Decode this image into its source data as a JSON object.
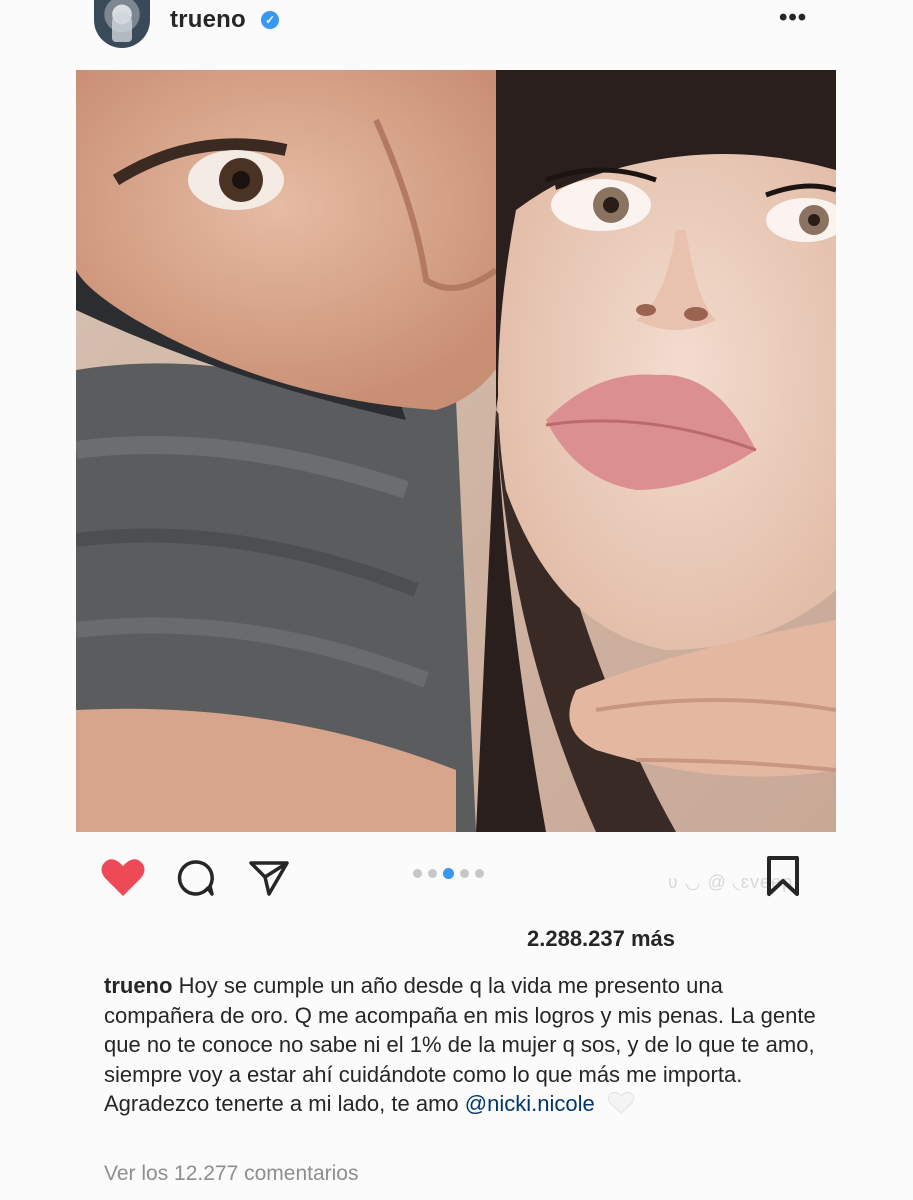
{
  "header": {
    "username": "trueno",
    "verified_icon": "verified-check-icon",
    "more_icon": "more-options-icon",
    "more_label": "•••"
  },
  "post": {
    "image_alt": "Selfie photo of two people",
    "carousel": {
      "total": 5,
      "active_index": 2
    },
    "watermark": "ʋ ◡ @ ◟ɛvɵɵp"
  },
  "actions": {
    "like_icon": "heart-filled-icon",
    "comment_icon": "comment-icon",
    "share_icon": "send-icon",
    "save_icon": "bookmark-icon",
    "like_color": "#ed4956"
  },
  "likes": {
    "text": "2.288.237 más"
  },
  "caption": {
    "username": "trueno",
    "text": "Hoy se cumple un año desde q la vida me presento una compañera de oro. Q me acompaña en mis logros y mis penas. La gente que no te conoce no sabe ni el 1% de la mujer q sos, y de lo que te amo, siempre voy a estar ahí cuidándote como lo que más me importa. Agradezco tenerte a mi lado, te amo",
    "mention": "@nicki.nicole",
    "emoji_icon": "white-heart-icon"
  },
  "comments": {
    "view_label": "Ver los 12.277 comentarios"
  }
}
